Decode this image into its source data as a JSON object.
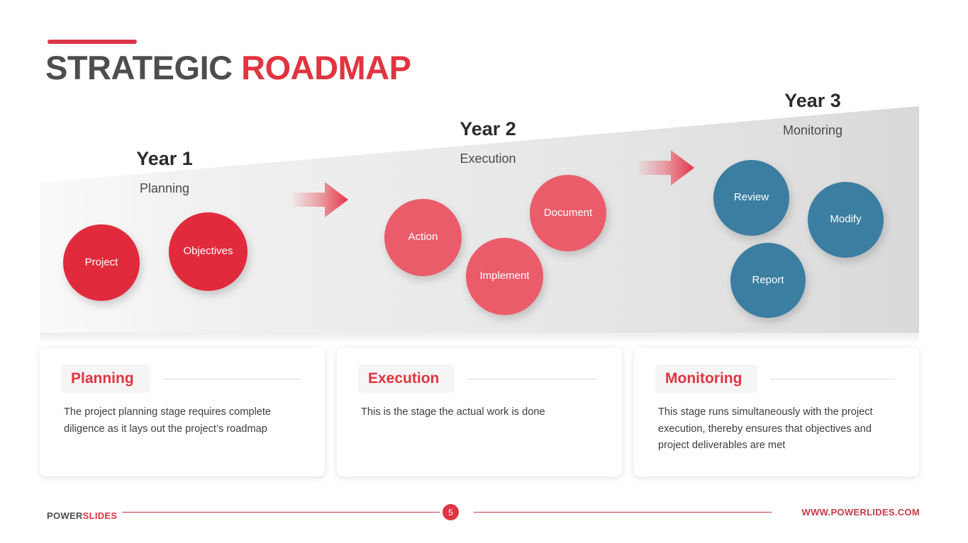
{
  "header": {
    "title_part1": "STRATEGIC",
    "title_part2": "ROADMAP",
    "accent_color": "#DC3545"
  },
  "timeline": {
    "stages": [
      {
        "year_label": "Year 1",
        "phase_label": "Planning",
        "bubble_color": "#E12B3C",
        "bubbles": [
          {
            "label": "Project"
          },
          {
            "label": "Objectives"
          }
        ]
      },
      {
        "year_label": "Year 2",
        "phase_label": "Execution",
        "bubble_color": "#EB5C6B",
        "bubbles": [
          {
            "label": "Action"
          },
          {
            "label": "Implement"
          },
          {
            "label": "Document"
          }
        ]
      },
      {
        "year_label": "Year 3",
        "phase_label": "Monitoring",
        "bubble_color": "#3B7EA1",
        "bubbles": [
          {
            "label": "Review"
          },
          {
            "label": "Modify"
          },
          {
            "label": "Report"
          }
        ]
      }
    ],
    "arrows": [
      {
        "name": "arrow-stage1-to-stage2"
      },
      {
        "name": "arrow-stage2-to-stage3"
      }
    ]
  },
  "cards": [
    {
      "title": "Planning",
      "body": "The project planning stage requires complete diligence as it lays out the project’s roadmap"
    },
    {
      "title": "Execution",
      "body": "This is the stage the actual work is done"
    },
    {
      "title": "Monitoring",
      "body": "This stage runs simultaneously with the project execution, thereby ensures that objectives and project deliverables are met"
    }
  ],
  "footer": {
    "brand_part1": "POWER",
    "brand_part2": "SLIDES",
    "page_number": "5",
    "website": "WWW.POWERLIDES.COM",
    "rule_color": "#C23B46"
  }
}
